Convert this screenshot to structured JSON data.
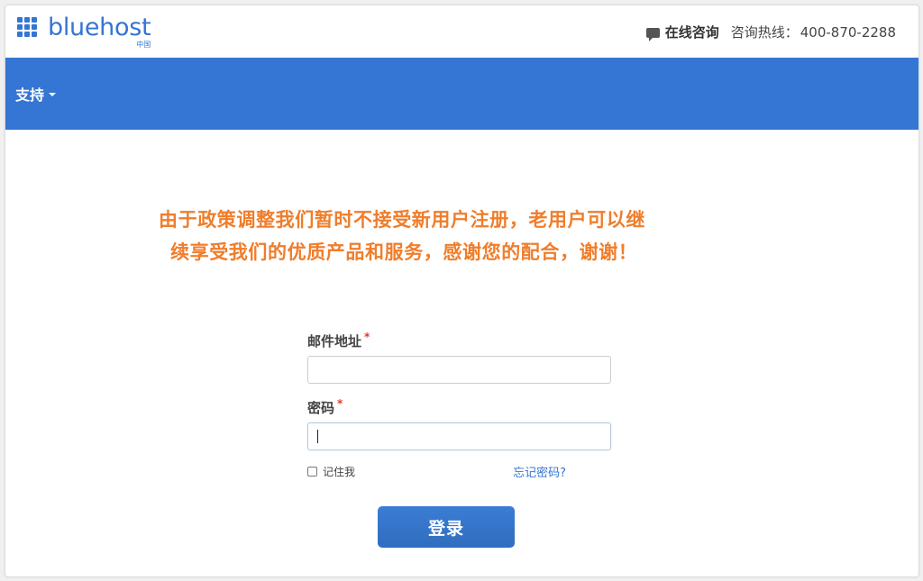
{
  "header": {
    "logo_text": "bluehost",
    "logo_sub": "中国",
    "online_consult": "在线咨询",
    "hotline_label": "咨询热线：",
    "hotline_number": "400-870-2288",
    "chat_icon": "chat-bubble-icon"
  },
  "nav": {
    "support_label": "支持"
  },
  "notice": {
    "line1": "由于政策调整我们暂时不接受新用户注册，老用户可以继",
    "line2": "续享受我们的优质产品和服务，感谢您的配合，谢谢！"
  },
  "form": {
    "email_label": "邮件地址",
    "email_value": "",
    "password_label": "密码",
    "password_value": "",
    "required_mark": "*",
    "remember_label": "记住我",
    "remember_checked": false,
    "forgot_label": "忘记密码?",
    "submit_label": "登录"
  },
  "colors": {
    "brand_blue": "#3575d3",
    "notice_orange": "#f07d2b",
    "required_red": "#e0392b"
  }
}
